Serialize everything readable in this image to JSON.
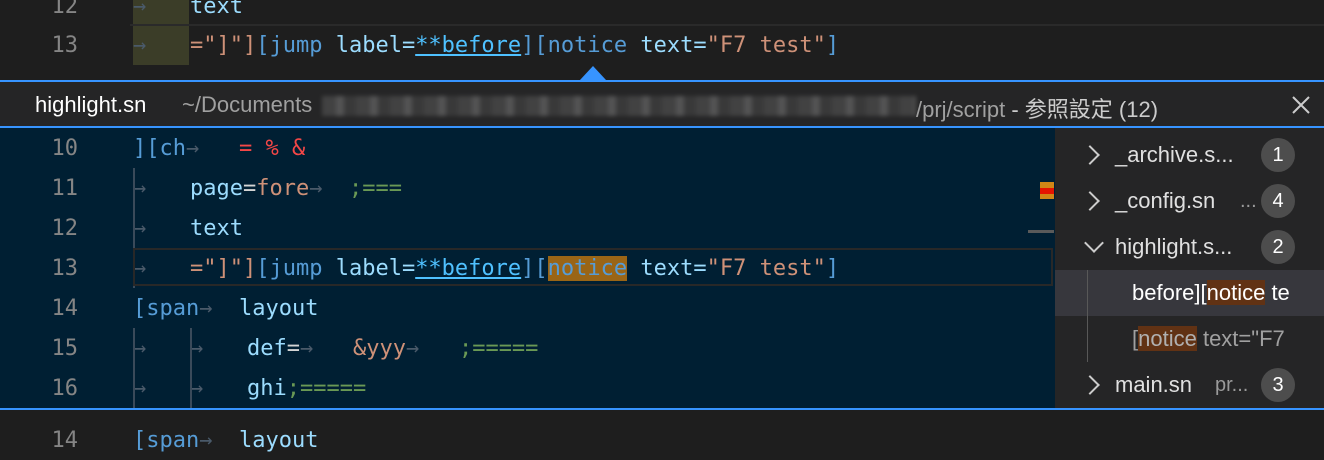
{
  "top_editor": {
    "lines": [
      {
        "num": "12",
        "text": "text"
      },
      {
        "num": "13",
        "segments": [
          {
            "t": "=\"]\"]",
            "c": "c-str"
          },
          {
            "t": "[jump",
            "c": "c-tag"
          },
          {
            "t": " label=",
            "c": "c-attr"
          },
          {
            "t": "**before",
            "c": "c-lnk"
          },
          {
            "t": "]",
            "c": "c-br"
          },
          {
            "t": "[notice",
            "c": "c-tag"
          },
          {
            "t": " text=",
            "c": "c-attr"
          },
          {
            "t": "\"F7 test\"",
            "c": "c-str"
          },
          {
            "t": "]",
            "c": "c-br"
          }
        ]
      }
    ]
  },
  "peek": {
    "filename": "highlight.sn",
    "path_prefix": "~/Documents",
    "path_suffix": "/prj/script",
    "title_suffix": " - 参照設定 (12)",
    "close_icon": "close-icon"
  },
  "peek_editor": {
    "lines": [
      {
        "num": "10",
        "segments": [
          {
            "t": "][ch",
            "c": "c-br"
          },
          {
            "t": "→   ",
            "c": "ws"
          },
          {
            "t": "= ",
            "c": "c-red"
          },
          {
            "t": "% ",
            "c": "c-red"
          },
          {
            "t": "&",
            "c": "c-red"
          }
        ]
      },
      {
        "num": "11",
        "indent": 1,
        "segments": [
          {
            "t": "page",
            "c": "c-attr"
          },
          {
            "t": "=",
            "c": "c-op"
          },
          {
            "t": "fore",
            "c": "c-str"
          },
          {
            "t": "→  ",
            "c": "ws"
          },
          {
            "t": ";===",
            "c": "c-cmt"
          }
        ]
      },
      {
        "num": "12",
        "indent": 1,
        "segments": [
          {
            "t": "text",
            "c": "c-attr"
          }
        ]
      },
      {
        "num": "13",
        "indent": 1,
        "segments": [
          {
            "t": "=\"]\"]",
            "c": "c-str"
          },
          {
            "t": "[jump",
            "c": "c-tag"
          },
          {
            "t": " label=",
            "c": "c-attr"
          },
          {
            "t": "**before",
            "c": "c-lnk"
          },
          {
            "t": "]",
            "c": "c-br"
          },
          {
            "t": "[",
            "c": "c-br"
          },
          {
            "t": "notice",
            "c": "c-tag",
            "hl": true
          },
          {
            "t": " text=",
            "c": "c-attr"
          },
          {
            "t": "\"F7 test\"",
            "c": "c-str"
          },
          {
            "t": "]",
            "c": "c-br"
          }
        ]
      },
      {
        "num": "14",
        "segments": [
          {
            "t": "[span",
            "c": "c-tag"
          },
          {
            "t": "→  ",
            "c": "ws"
          },
          {
            "t": "layout",
            "c": "c-attr"
          }
        ]
      },
      {
        "num": "15",
        "indent": 2,
        "segments": [
          {
            "t": "def",
            "c": "c-attr"
          },
          {
            "t": "=",
            "c": "c-op"
          },
          {
            "t": "→   ",
            "c": "ws"
          },
          {
            "t": "&yyy",
            "c": "c-str"
          },
          {
            "t": "→   ",
            "c": "ws"
          },
          {
            "t": ";=====",
            "c": "c-cmt"
          }
        ]
      },
      {
        "num": "16",
        "indent": 2,
        "segments": [
          {
            "t": "ghi",
            "c": "c-attr"
          },
          {
            "t": ";=====",
            "c": "c-cmt"
          }
        ]
      }
    ]
  },
  "references": [
    {
      "name": "_archive.s...",
      "detail": "",
      "count": "1",
      "expanded": false
    },
    {
      "name": "_config.sn",
      "detail": "...",
      "count": "4",
      "expanded": false
    },
    {
      "name": "highlight.s...",
      "detail": "",
      "count": "2",
      "expanded": true,
      "children": [
        {
          "pre": "before][",
          "hl": "notice",
          "post": " te",
          "selected": true
        },
        {
          "pre": "[",
          "hl": "notice",
          "post": " text=\"F7",
          "selected": false
        }
      ]
    },
    {
      "name": "main.sn",
      "detail": "pr...",
      "count": "3",
      "expanded": false
    }
  ],
  "bottom_editor": {
    "num": "14",
    "segments": [
      {
        "t": "[span",
        "c": "c-tag"
      },
      {
        "t": "→  ",
        "c": "ws"
      },
      {
        "t": "layout",
        "c": "c-attr"
      }
    ]
  },
  "colors": {
    "accent": "#3794ff",
    "match_highlight": "#9a6516",
    "ref_highlight": "#613214"
  }
}
